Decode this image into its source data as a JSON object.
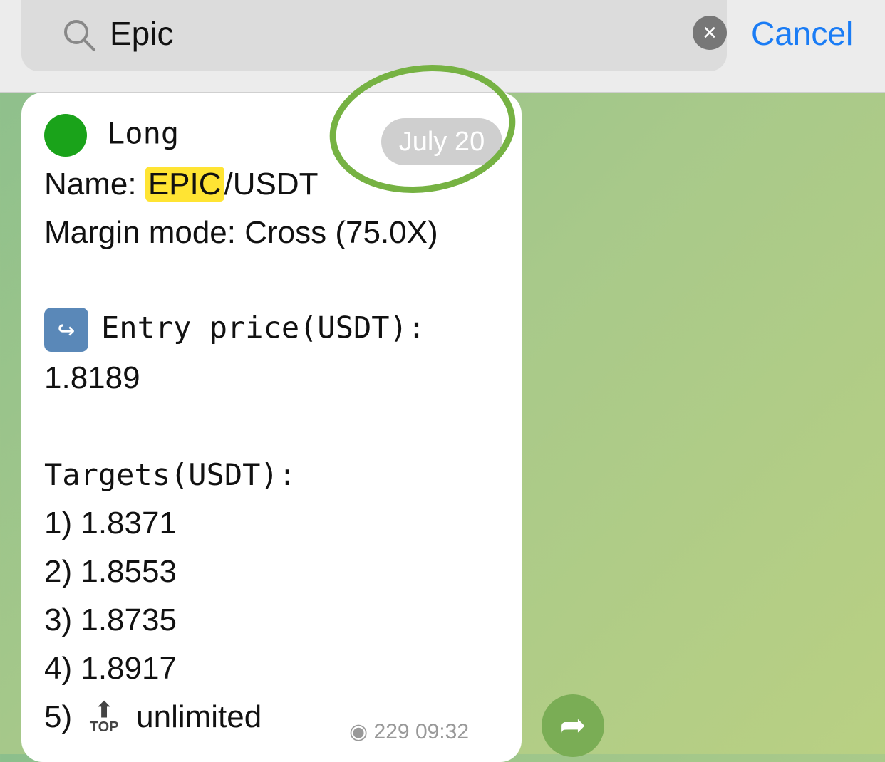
{
  "search": {
    "query": "Epic",
    "cancel_label": "Cancel"
  },
  "message": {
    "date": "July 20",
    "direction": "Long",
    "name_label": "Name: ",
    "name_highlight": "EPIC",
    "name_rest": "/USDT",
    "margin": "Margin mode: Cross (75.0X)",
    "entry_label": "Entry price(USDT):",
    "entry_value": "1.8189",
    "targets_label": "Targets(USDT):",
    "targets": [
      "1) 1.8371",
      "2) 1.8553",
      "3) 1.8735",
      "4) 1.8917"
    ],
    "target5_num": "5)",
    "target5_badge": "TOP",
    "target5_value": "unlimited",
    "views": "229",
    "time": "09:32"
  },
  "colors": {
    "accent": "#1a7cf5",
    "highlight": "#ffe433",
    "ring": "#76b243"
  }
}
